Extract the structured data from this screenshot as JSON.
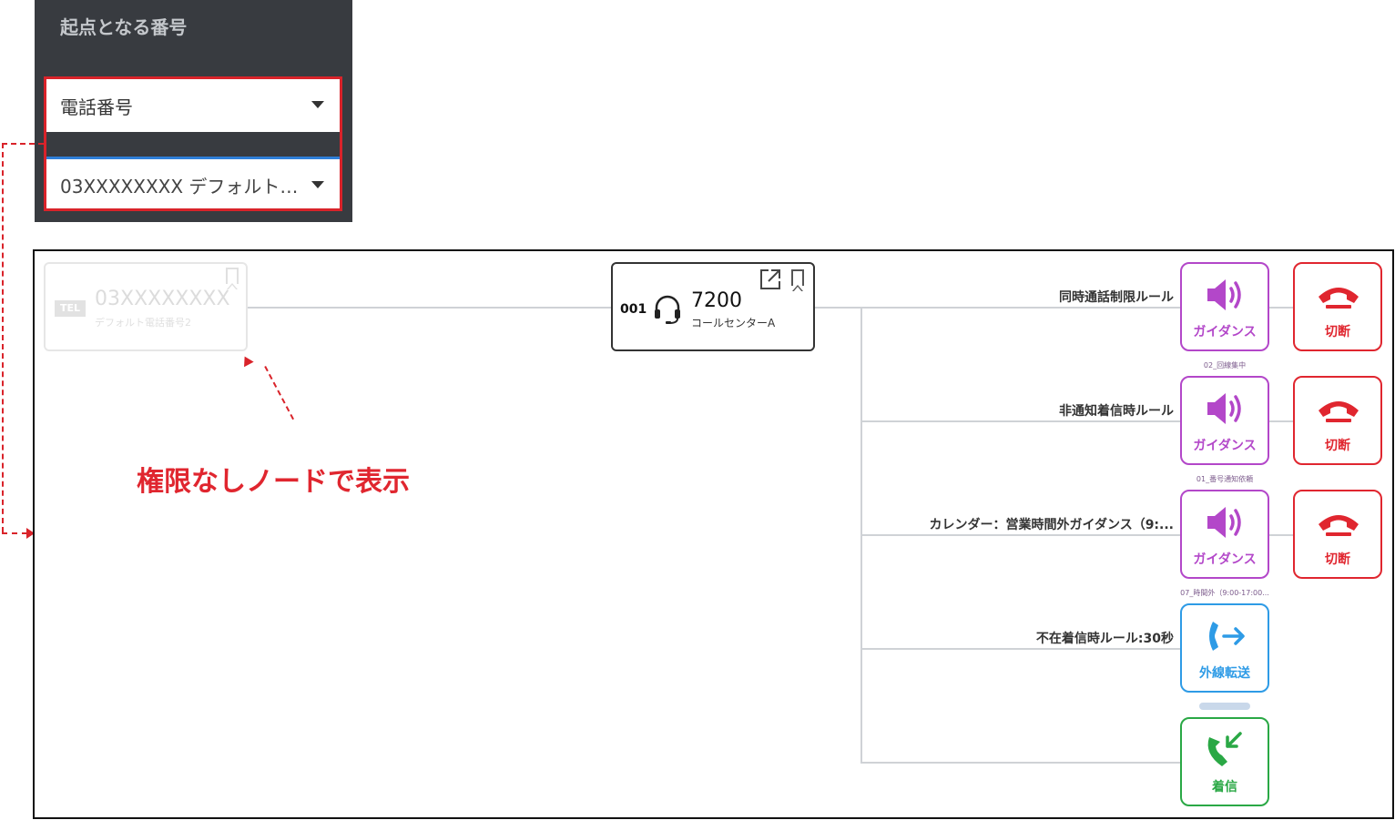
{
  "panel": {
    "title": "起点となる番号",
    "type_select": "電話番号",
    "number_select": "03XXXXXXXX デフォルト…"
  },
  "annotation": "権限なしノードで表示",
  "start_node": {
    "badge": "TEL",
    "number": "03XXXXXXXX",
    "sub": "デフォルト電話番号2"
  },
  "queue_node": {
    "id": "001",
    "number": "7200",
    "name": "コールセンターA"
  },
  "rules": [
    {
      "label": "同時通話制限ルール",
      "action": "ガイダンス",
      "caption": "02_回線集中",
      "end": "切断"
    },
    {
      "label": "非通知着信時ルール",
      "action": "ガイダンス",
      "caption": "01_番号通知依頼",
      "end": "切断"
    },
    {
      "label": "カレンダー：営業時間外ガイダンス（9:...",
      "action": "ガイダンス",
      "caption": "07_時間外（9:00-17:00...",
      "end": "切断"
    },
    {
      "label": "不在着信時ルール:30秒",
      "action": "外線転送"
    },
    {
      "action": "着信"
    }
  ],
  "colors": {
    "highlight": "#d9232a",
    "guidance": "#b347c9",
    "disconnect": "#e0262f",
    "transfer": "#2e9be6",
    "incoming": "#2aa845"
  },
  "icons": [
    "caret-down-icon",
    "bookmark-icon",
    "headset-icon",
    "external-link-icon",
    "speaker-icon",
    "hangup-icon",
    "transfer-out-icon",
    "incoming-call-icon"
  ]
}
